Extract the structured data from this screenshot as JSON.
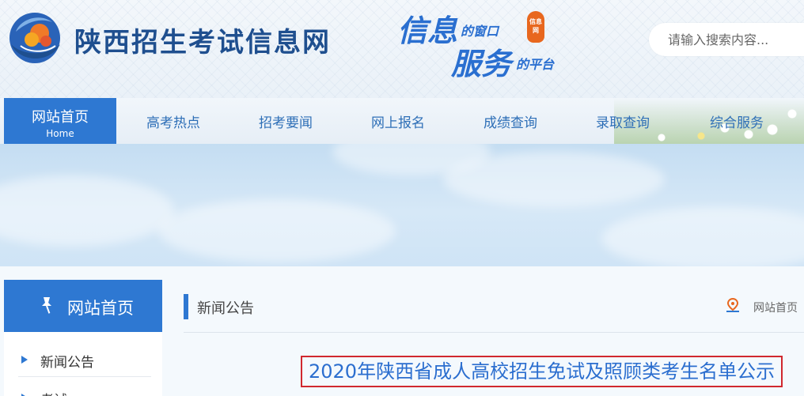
{
  "header": {
    "site_title": "陕西招生考试信息网",
    "slogan": {
      "line1_big": "信息",
      "line1_small": "的窗口",
      "line2_big": "服务",
      "line2_small": "的平台",
      "seal_text": "信息网"
    },
    "search_placeholder": "请输入搜索内容..."
  },
  "nav": {
    "home_label": "网站首页",
    "home_sub": "Home",
    "items": [
      "高考热点",
      "招考要闻",
      "网上报名",
      "成绩查询",
      "录取查询",
      "综合服务"
    ]
  },
  "sidebar": {
    "title": "网站首页",
    "items": [
      "新闻公告",
      "考试"
    ]
  },
  "main": {
    "section_title": "新闻公告",
    "breadcrumb": "网站首页",
    "article_title": "2020年陕西省成人高校招生免试及照顾类考生名单公示"
  },
  "colors": {
    "primary": "#2e78d2",
    "nav_text": "#2e6fb7",
    "highlight_border": "#d0282e"
  },
  "icons": [
    "logo-icon",
    "pin-icon",
    "location-icon",
    "arrow-right-icon"
  ]
}
